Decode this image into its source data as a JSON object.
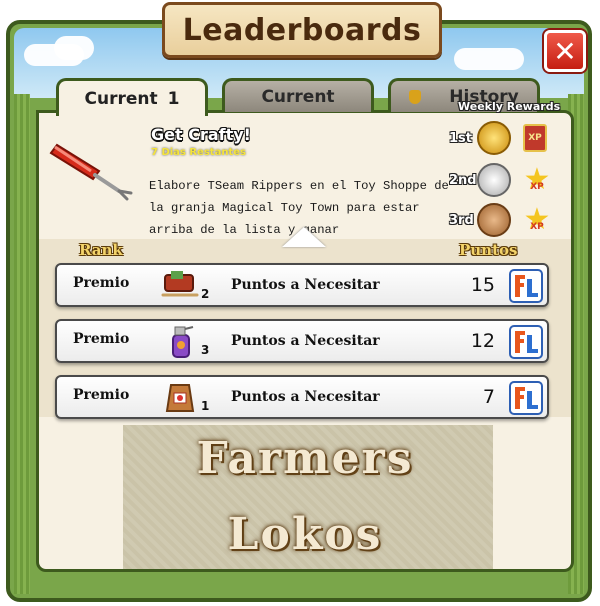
{
  "window": {
    "title": "Leaderboards",
    "close_glyph": "✕"
  },
  "tabs": [
    {
      "label": "Current",
      "number": "1",
      "active": true
    },
    {
      "label": "Current",
      "active": false
    },
    {
      "label": "History",
      "icon": "trophy-icon",
      "active": false
    }
  ],
  "weekly_rewards_label": "Weekly Rewards",
  "quest": {
    "title": "Get Crafty!",
    "days_left": "7 Dias Restantes",
    "description": "Elabore TSeam Rippers en el Toy Shoppe de la granja Magical Toy Town para estar arriba de la lista y ganar bonificaciones.",
    "icon": "seam-ripper-icon"
  },
  "rewards": [
    {
      "place": "1st",
      "medal": "gold-trophy-icon",
      "bonus": "XP"
    },
    {
      "place": "2nd",
      "medal": "silver-trophy-icon",
      "bonus": "XP"
    },
    {
      "place": "3rd",
      "medal": "bronze-trophy-icon",
      "bonus": "XP"
    }
  ],
  "table": {
    "rank_header": "Rank",
    "points_header": "Puntos",
    "rows": [
      {
        "label": "Premio",
        "item_icon": "sleigh-icon",
        "qty": "2",
        "need": "Puntos a Necesitar",
        "points": "15",
        "currency_icon": "fl-logo-icon"
      },
      {
        "label": "Premio",
        "item_icon": "spray-bottle-icon",
        "qty": "3",
        "need": "Puntos a Necesitar",
        "points": "12",
        "currency_icon": "fl-logo-icon"
      },
      {
        "label": "Premio",
        "item_icon": "seed-bag-icon",
        "qty": "1",
        "need": "Puntos a Necesitar",
        "points": "7",
        "currency_icon": "fl-logo-icon"
      }
    ]
  },
  "watermark": {
    "line1": "Farmers",
    "line2": "Lokos"
  },
  "colors": {
    "frame_green": "#3d5a1d",
    "panel_bg": "#f7f1e3",
    "close_red": "#d9281a",
    "gold": "#e2a81c"
  }
}
